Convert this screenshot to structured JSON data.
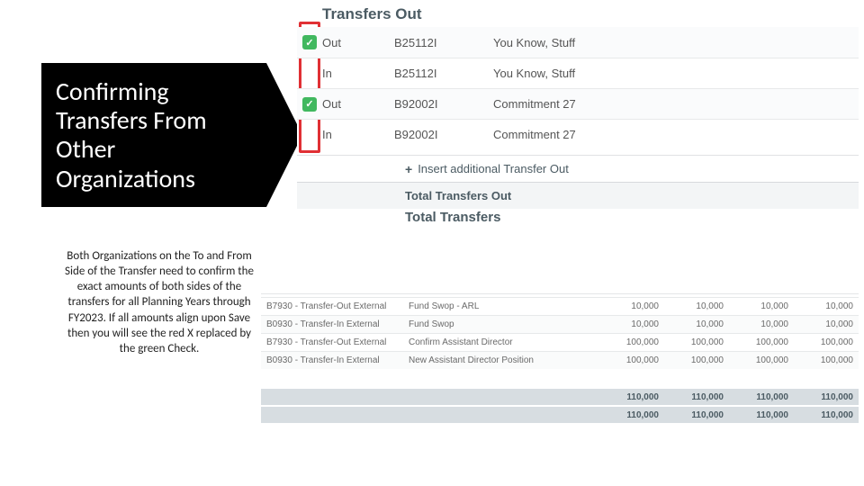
{
  "callout": {
    "title": "Confirming Transfers From Other Organizations",
    "body": "Both Organizations on the To and From Side of the Transfer need to confirm the exact amounts of both sides of the transfers for all Planning Years through FY2023. If all amounts align upon Save then you will see the red X replaced by the green Check."
  },
  "upper": {
    "header": "Transfers Out",
    "rows": [
      {
        "confirmed": true,
        "dir": "Out",
        "code": "B25112I",
        "desc": "You Know, Stuff"
      },
      {
        "confirmed": false,
        "dir": "In",
        "code": "B25112I",
        "desc": "You Know, Stuff"
      },
      {
        "confirmed": true,
        "dir": "Out",
        "code": "B92002I",
        "desc": "Commitment 27"
      },
      {
        "confirmed": false,
        "dir": "In",
        "code": "B92002I",
        "desc": "Commitment 27"
      }
    ],
    "insert_label": "Insert additional Transfer Out",
    "total_out_label": "Total Transfers Out",
    "total_transfers_label": "Total Transfers"
  },
  "lower": {
    "rows": [
      {
        "type": "B7930 - Transfer-Out External",
        "desc": "Fund Swop - ARL",
        "v": [
          "10,000",
          "10,000",
          "10,000",
          "10,000"
        ]
      },
      {
        "type": "B0930 - Transfer-In External",
        "desc": "Fund Swop",
        "v": [
          "10,000",
          "10,000",
          "10,000",
          "10,000"
        ]
      },
      {
        "type": "B7930 - Transfer-Out External",
        "desc": "Confirm Assistant Director",
        "v": [
          "100,000",
          "100,000",
          "100,000",
          "100,000"
        ]
      },
      {
        "type": "B0930 - Transfer-In External",
        "desc": "New Assistant Director Position",
        "v": [
          "100,000",
          "100,000",
          "100,000",
          "100,000"
        ]
      }
    ],
    "totals": [
      [
        "110,000",
        "110,000",
        "110,000",
        "110,000"
      ],
      [
        "110,000",
        "110,000",
        "110,000",
        "110,000"
      ]
    ]
  }
}
